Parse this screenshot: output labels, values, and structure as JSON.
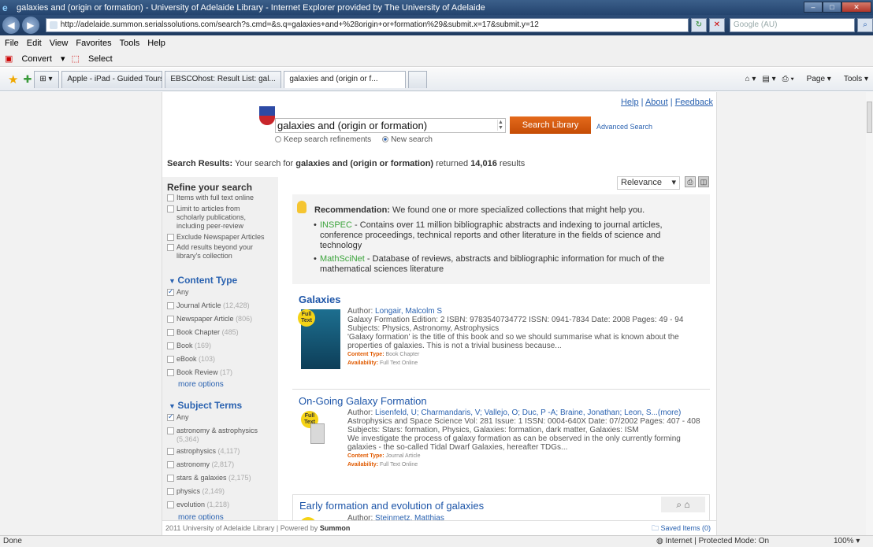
{
  "window": {
    "title": "galaxies and (origin or formation) - University of Adelaide Library - Internet Explorer provided by The University of Adelaide"
  },
  "address": {
    "url": "http://adelaide.summon.serialssolutions.com/search?s.cmd=&s.q=galaxies+and+%28origin+or+formation%29&submit.x=17&submit.y=12",
    "search_placeholder": "Google (AU)"
  },
  "menu": [
    "File",
    "Edit",
    "View",
    "Favorites",
    "Tools",
    "Help"
  ],
  "convert": {
    "convert": "Convert",
    "select": "Select"
  },
  "tabs": [
    "Apple - iPad - Guided Tours",
    "EBSCOhost: Result List: gal...",
    "galaxies and (origin or f..."
  ],
  "commands": {
    "page": "Page",
    "tools": "Tools"
  },
  "toplinks": {
    "help": "Help",
    "about": "About",
    "feedback": "Feedback"
  },
  "search": {
    "query": "galaxies and (origin or formation)",
    "button": "Search Library",
    "advanced": "Advanced Search",
    "keep": "Keep search refinements",
    "new": "New search"
  },
  "results_line": {
    "prefix": "Search Results:",
    "text": "Your search for",
    "query": "galaxies and (origin or formation)",
    "returned": "returned",
    "count": "14,016",
    "suffix": "results"
  },
  "refine": {
    "title": "Refine your search",
    "options": [
      "Items with full text online",
      "Limit to articles from scholarly publications, including peer-review",
      "Exclude Newspaper Articles",
      "Add results beyond your library's collection"
    ]
  },
  "content_type": {
    "title": "Content Type",
    "items": [
      {
        "label": "Any",
        "count": ""
      },
      {
        "label": "Journal Article",
        "count": "(12,428)"
      },
      {
        "label": "Newspaper Article",
        "count": "(806)"
      },
      {
        "label": "Book Chapter",
        "count": "(485)"
      },
      {
        "label": "Book",
        "count": "(169)"
      },
      {
        "label": "eBook",
        "count": "(103)"
      },
      {
        "label": "Book Review",
        "count": "(17)"
      }
    ],
    "more": "more options"
  },
  "subject_terms": {
    "title": "Subject Terms",
    "items": [
      {
        "label": "Any",
        "count": ""
      },
      {
        "label": "astronomy & astrophysics",
        "count": "(5,364)"
      },
      {
        "label": "astrophysics",
        "count": "(4,117)"
      },
      {
        "label": "astronomy",
        "count": "(2,817)"
      },
      {
        "label": "stars & galaxies",
        "count": "(2,175)"
      },
      {
        "label": "physics",
        "count": "(2,149)"
      },
      {
        "label": "evolution",
        "count": "(1,218)"
      }
    ],
    "more": "more options"
  },
  "sort": {
    "selected": "Relevance"
  },
  "recommendation": {
    "label": "Recommendation:",
    "text": "We found one or more specialized collections that might help you.",
    "items": [
      {
        "name": "INSPEC",
        "desc": " - Contains over 11 million bibliographic abstracts and indexing to journal articles, conference proceedings, technical reports and other literature in the fields of science and technology"
      },
      {
        "name": "MathSciNet",
        "desc": " - Database of reviews, abstracts and bibliographic information for much of the mathematical sciences literature"
      }
    ]
  },
  "results": [
    {
      "title": "Galaxies",
      "author_label": "Author:",
      "author": "Longair, Malcolm S",
      "line2": "Galaxy Formation Edition: 2 ISBN: 9783540734772 ISSN: 0941-7834 Date: 2008 Pages: 49 - 94",
      "subjects": "Subjects: Physics, Astronomy, Astrophysics",
      "snippet": "'Galaxy formation' is the title of this book and so we should summarise what is known about the properties of galaxies. This is not a trivial business because...",
      "content_type_label": "Content Type:",
      "content_type": "Book Chapter",
      "availability_label": "Availability:",
      "availability": "Full Text Online",
      "badge": "Full Text"
    },
    {
      "title": "On-Going Galaxy Formation",
      "author_label": "Author:",
      "author": "Lisenfeld, U; Charmandaris, V; Vallejo, O; Duc, P -A; Braine, Jonathan; Leon, S...(more)",
      "line2": "Astrophysics and Space Science Vol: 281 Issue: 1 ISSN: 0004-640X Date: 07/2002 Pages: 407 - 408",
      "subjects": "Subjects: Stars: formation, Physics, Galaxies: formation, dark matter, Galaxies: ISM",
      "snippet": "We investigate the process of galaxy formation as can be observed in the only currently forming galaxies - the so-called Tidal Dwarf Galaxies, hereafter TDGs...",
      "content_type_label": "Content Type:",
      "content_type": "Journal Article",
      "availability_label": "Availability:",
      "availability": "Full Text Online",
      "badge": "Full Text"
    },
    {
      "title": "Early formation and evolution of galaxies",
      "author_label": "Author:",
      "author": "Steinmetz, Matthias"
    }
  ],
  "footer": {
    "copyright": "2011 University of Adelaide Library",
    "powered": "Powered by",
    "summon": "Summon",
    "saved": "Saved Items (0)"
  },
  "status": {
    "done": "Done",
    "zone": "Internet | Protected Mode: On",
    "zoom": "100%"
  }
}
